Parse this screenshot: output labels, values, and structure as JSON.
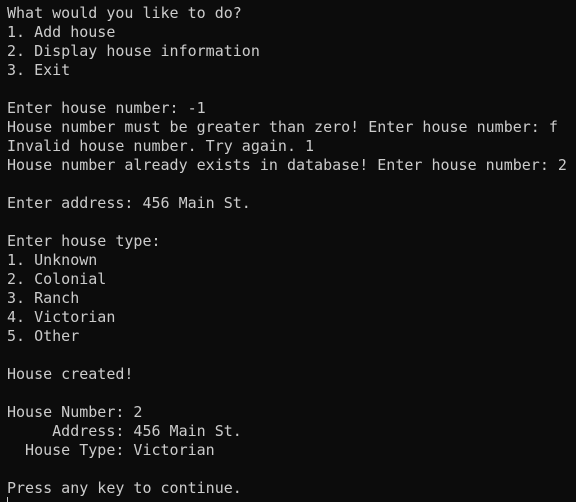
{
  "terminal": {
    "lines": [
      "What would you like to do?",
      "1. Add house",
      "2. Display house information",
      "3. Exit",
      "",
      "Enter house number: -1",
      "House number must be greater than zero! Enter house number: f",
      "Invalid house number. Try again. 1",
      "House number already exists in database! Enter house number: 2",
      "",
      "Enter address: 456 Main St.",
      "",
      "Enter house type:",
      "1. Unknown",
      "2. Colonial",
      "3. Ranch",
      "4. Victorian",
      "5. Other",
      "",
      "House created!",
      "",
      "House Number: 2",
      "     Address: 456 Main St.",
      "  House Type: Victorian",
      "",
      "Press any key to continue."
    ]
  },
  "colors": {
    "background": "#0c0c0c",
    "foreground": "#cccccc"
  }
}
